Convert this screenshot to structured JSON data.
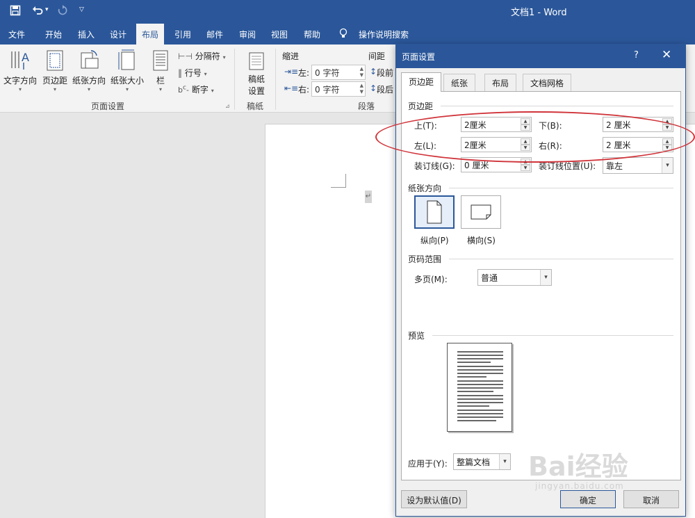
{
  "app": {
    "title": "文档1 - Word",
    "colors": {
      "accent": "#2b579a",
      "ribbon_bg": "#f3f3f3",
      "highlight_ellipse": "#d0343a"
    }
  },
  "quick_access": {
    "save_icon": "save-icon",
    "undo_icon": "undo-icon",
    "undo_more": "▾",
    "redo_icon": "redo-icon",
    "customize_icon": "customize-dropdown-icon"
  },
  "menu": {
    "tabs": [
      "文件",
      "开始",
      "插入",
      "设计",
      "布局",
      "引用",
      "邮件",
      "审阅",
      "视图",
      "帮助"
    ],
    "active_tab": "布局",
    "search_label": "操作说明搜索"
  },
  "ribbon": {
    "page_setup": {
      "text_direction": "文字方向",
      "margins": "页边距",
      "orientation": "纸张方向",
      "size": "纸张大小",
      "columns": "栏",
      "breaks": "分隔符",
      "line_numbers": "行号",
      "hyphenation": "断字",
      "group_label": "页面设置",
      "dropdown_marker": "▾"
    },
    "draft_paper": {
      "button_line1": "稿纸",
      "button_line2": "设置",
      "group_label": "稿纸"
    },
    "paragraph": {
      "indent_label": "缩进",
      "spacing_label": "间距",
      "indent_left_label": "左:",
      "indent_left_value": "0 字符",
      "indent_right_label": "右:",
      "indent_right_value": "0 字符",
      "spacing_before_label": "段前",
      "spacing_after_label": "段后",
      "group_label": "段落"
    }
  },
  "document": {
    "paragraph_mark": "↵"
  },
  "dialog": {
    "title": "页面设置",
    "help": "?",
    "close": "✕",
    "tabs": [
      "页边距",
      "纸张",
      "布局",
      "文档网格"
    ],
    "active_tab": "页边距",
    "margins": {
      "section_title": "页边距",
      "top_label": "上(T):",
      "top_value": "2厘米",
      "bottom_label": "下(B):",
      "bottom_value": "2 厘米",
      "left_label": "左(L):",
      "left_value": "2厘米",
      "right_label": "右(R):",
      "right_value": "2 厘米",
      "gutter_label": "装订线(G):",
      "gutter_value": "0 厘米",
      "gutter_pos_label": "装订线位置(U):",
      "gutter_pos_value": "靠左"
    },
    "orientation": {
      "section_title": "纸张方向",
      "portrait": "纵向(P)",
      "landscape": "横向(S)",
      "selected": "portrait"
    },
    "pages": {
      "section_title": "页码范围",
      "multiple_label": "多页(M):",
      "multiple_value": "普通"
    },
    "preview": {
      "section_title": "预览"
    },
    "apply": {
      "label": "应用于(Y):",
      "value": "整篇文档"
    },
    "buttons": {
      "set_default": "设为默认值(D)",
      "ok": "确定",
      "cancel": "取消"
    }
  },
  "watermark": {
    "brand": "Bai经验",
    "url": "jingyan.baidu.com"
  }
}
